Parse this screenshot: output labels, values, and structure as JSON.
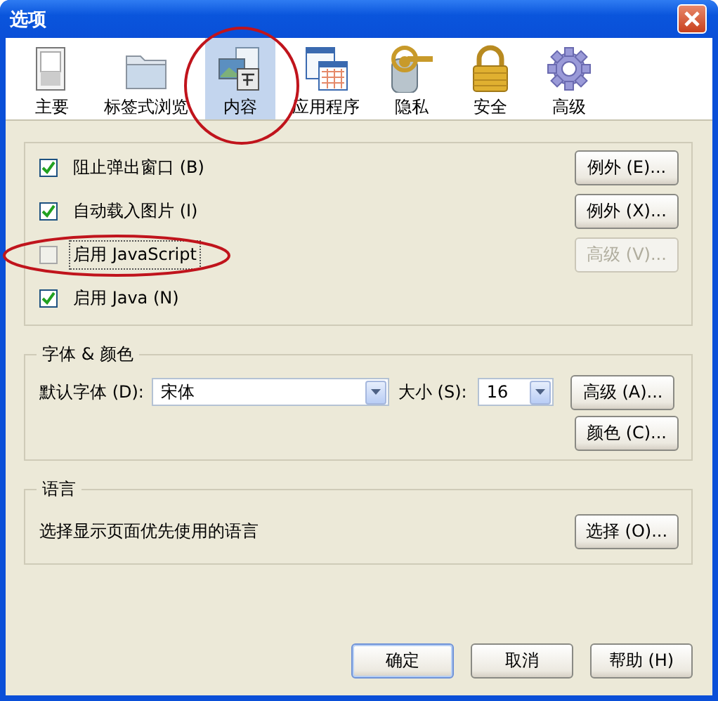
{
  "window": {
    "title": "选项"
  },
  "tabs": [
    {
      "label": "主要",
      "selected": false
    },
    {
      "label": "标签式浏览",
      "selected": false
    },
    {
      "label": "内容",
      "selected": true
    },
    {
      "label": "应用程序",
      "selected": false
    },
    {
      "label": "隐私",
      "selected": false
    },
    {
      "label": "安全",
      "selected": false
    },
    {
      "label": "高级",
      "selected": false
    }
  ],
  "content_group": {
    "rows": [
      {
        "label": "阻止弹出窗口 (B)",
        "checked": true,
        "focused": false,
        "button": {
          "label": "例外 (E)...",
          "disabled": false
        }
      },
      {
        "label": "自动载入图片 (I)",
        "checked": true,
        "focused": false,
        "button": {
          "label": "例外 (X)...",
          "disabled": false
        }
      },
      {
        "label": "启用 JavaScript",
        "checked": false,
        "focused": true,
        "button": {
          "label": "高级 (V)...",
          "disabled": true
        }
      },
      {
        "label": "启用 Java (N)",
        "checked": true,
        "focused": false
      }
    ]
  },
  "fonts_group": {
    "title": "字体 & 颜色",
    "font_label": "默认字体 (D):",
    "font_value": "宋体",
    "size_label": "大小 (S):",
    "size_value": "16",
    "buttons": [
      "高级 (A)...",
      "颜色 (C)..."
    ]
  },
  "language_group": {
    "title": "语言",
    "text": "选择显示页面优先使用的语言",
    "button": "选择 (O)..."
  },
  "buttons": [
    {
      "label": "确定",
      "default": true
    },
    {
      "label": "取消",
      "default": false
    },
    {
      "label": "帮助 (H)",
      "default": false
    }
  ]
}
